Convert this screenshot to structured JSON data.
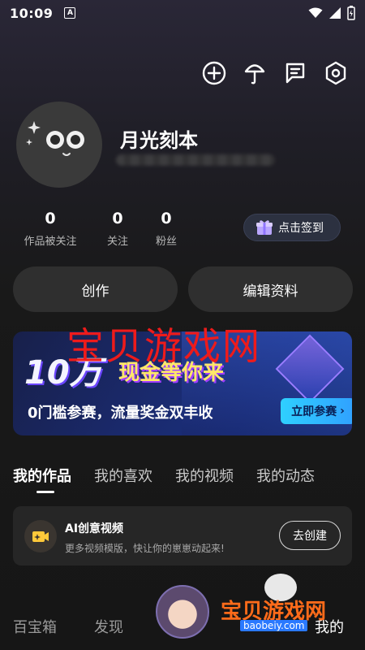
{
  "status_bar": {
    "time": "10:09",
    "indicator": "A"
  },
  "header": {
    "icons": [
      "add-circle-icon",
      "umbrella-icon",
      "message-icon",
      "settings-icon"
    ]
  },
  "profile": {
    "username": "月光刻本",
    "user_id": ""
  },
  "stats": [
    {
      "value": "0",
      "label": "作品被关注"
    },
    {
      "value": "0",
      "label": "关注"
    },
    {
      "value": "0",
      "label": "粉丝"
    }
  ],
  "checkin": {
    "label": "点击签到"
  },
  "actions": {
    "create": "创作",
    "edit_profile": "编辑资料"
  },
  "banner": {
    "title_big": "10万",
    "title_rest": "现金等你来",
    "subtitle": "0门槛参赛，流量奖金双丰收",
    "button": "立即参赛"
  },
  "watermark": {
    "text": "宝贝游戏网",
    "small": "宝贝游戏网",
    "url": "baobeiy.com"
  },
  "tabs": [
    "我的作品",
    "我的喜欢",
    "我的视频",
    "我的动态"
  ],
  "active_tab": 0,
  "ai_card": {
    "title": "AI创意视频",
    "subtitle": "更多视频模版，快让你的崽崽动起来!",
    "button": "去创建"
  },
  "bottom_nav": {
    "item1": "百宝箱",
    "item2": "发现",
    "item_last": "我的"
  },
  "colors": {
    "accent_red": "#ee1b1b",
    "banner_button": "#30a0ff"
  }
}
